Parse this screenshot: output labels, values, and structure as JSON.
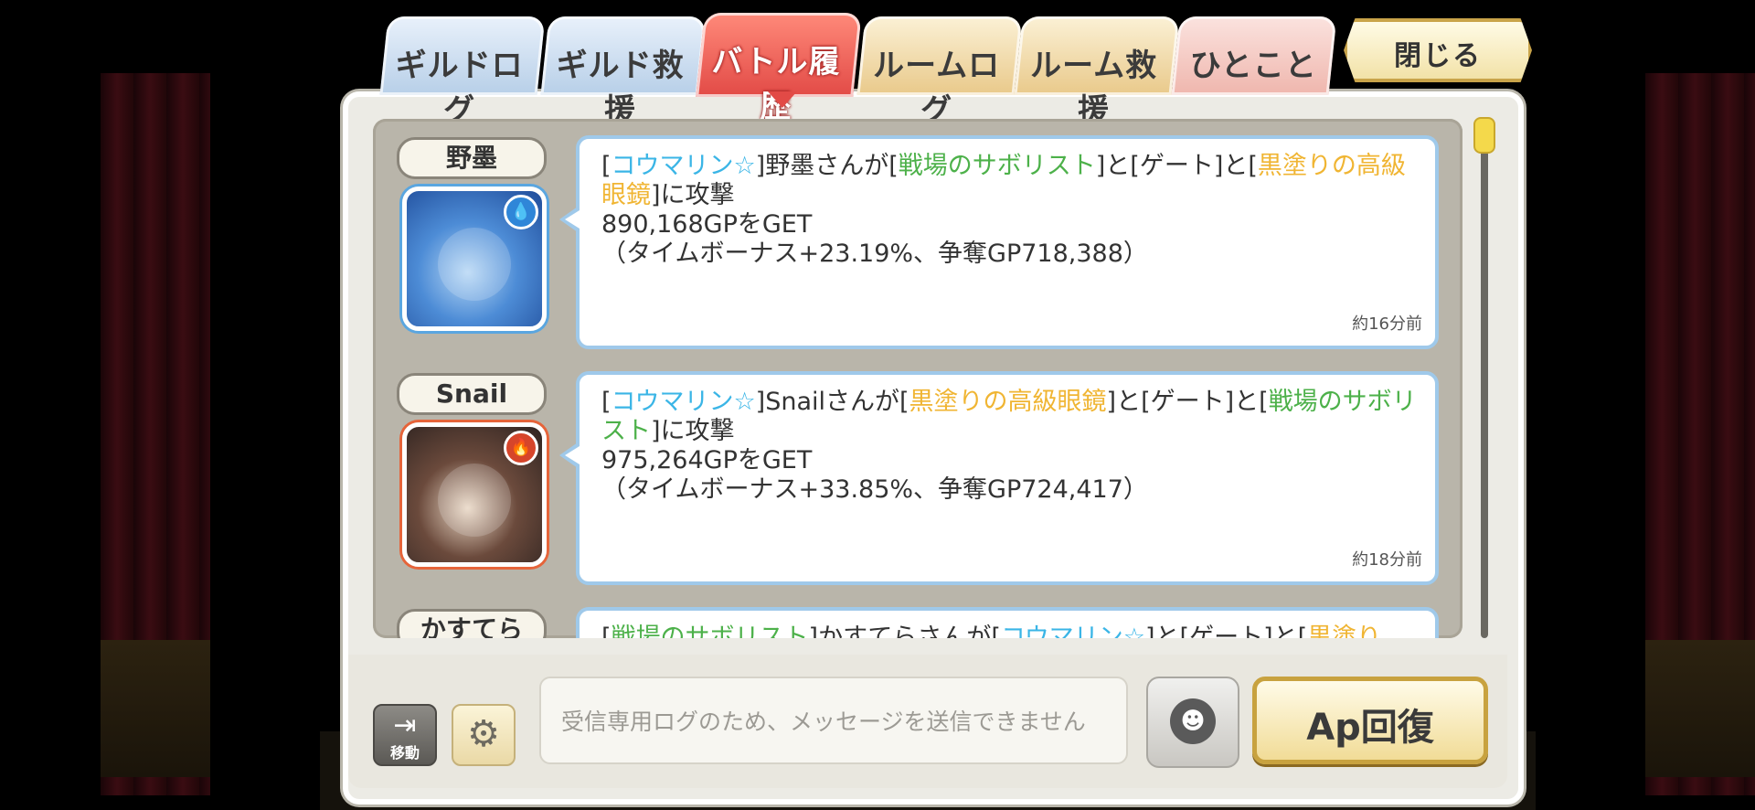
{
  "tabs": [
    {
      "label": "ギルドログ",
      "color": "blue",
      "active": false
    },
    {
      "label": "ギルド救援",
      "color": "blue",
      "active": false
    },
    {
      "label": "バトル履歴",
      "color": "red",
      "active": true
    },
    {
      "label": "ルームログ",
      "color": "gold",
      "active": false
    },
    {
      "label": "ルーム救援",
      "color": "gold",
      "active": false
    },
    {
      "label": "ひとこと",
      "color": "pink",
      "active": false
    }
  ],
  "close_label": "閉じる",
  "log": {
    "entries": [
      {
        "name": "野墨",
        "attribute_icon": "water-icon",
        "parts": [
          {
            "t": "[",
            "c": ""
          },
          {
            "t": "コウマリン☆",
            "c": "cyan"
          },
          {
            "t": "]野墨さんが[",
            "c": ""
          },
          {
            "t": "戦場のサボリスト",
            "c": "green"
          },
          {
            "t": "]と[ゲート]と[",
            "c": ""
          },
          {
            "t": "黒塗りの高級眼鏡",
            "c": "yellow"
          },
          {
            "t": "]に攻撃",
            "c": ""
          }
        ],
        "line2": "890,168GPをGET",
        "line3": "（タイムボーナス+23.19%、争奪GP718,388）",
        "time": "約16分前"
      },
      {
        "name": "Snail",
        "attribute_icon": "fire-icon",
        "parts": [
          {
            "t": "[",
            "c": ""
          },
          {
            "t": "コウマリン☆",
            "c": "cyan"
          },
          {
            "t": "]Snailさんが[",
            "c": ""
          },
          {
            "t": "黒塗りの高級眼鏡",
            "c": "yellow"
          },
          {
            "t": "]と[ゲート]と[",
            "c": ""
          },
          {
            "t": "戦場のサボリスト",
            "c": "green"
          },
          {
            "t": "]に攻撃",
            "c": ""
          }
        ],
        "line2": "975,264GPをGET",
        "line3": "（タイムボーナス+33.85%、争奪GP724,417）",
        "time": "約18分前"
      },
      {
        "name": "かすてら",
        "attribute_icon": "",
        "parts": [
          {
            "t": "[",
            "c": ""
          },
          {
            "t": "戦場のサボリスト",
            "c": "green"
          },
          {
            "t": "]かすてらさんが[",
            "c": ""
          },
          {
            "t": "コウマリン☆",
            "c": "cyan"
          },
          {
            "t": "]と[ゲート]と[",
            "c": ""
          },
          {
            "t": "黒塗り",
            "c": "yellow"
          }
        ],
        "line2": "",
        "line3": "",
        "time": ""
      }
    ]
  },
  "bottom": {
    "move_label": "移動",
    "input_placeholder": "受信専用ログのため、メッセージを送信できません",
    "ap_label": "Ap回復"
  },
  "colors": {
    "accent_red": "#e24a46",
    "cyan_text": "#3ab5e6",
    "green_text": "#4db14a",
    "yellow_text": "#f0b533"
  }
}
